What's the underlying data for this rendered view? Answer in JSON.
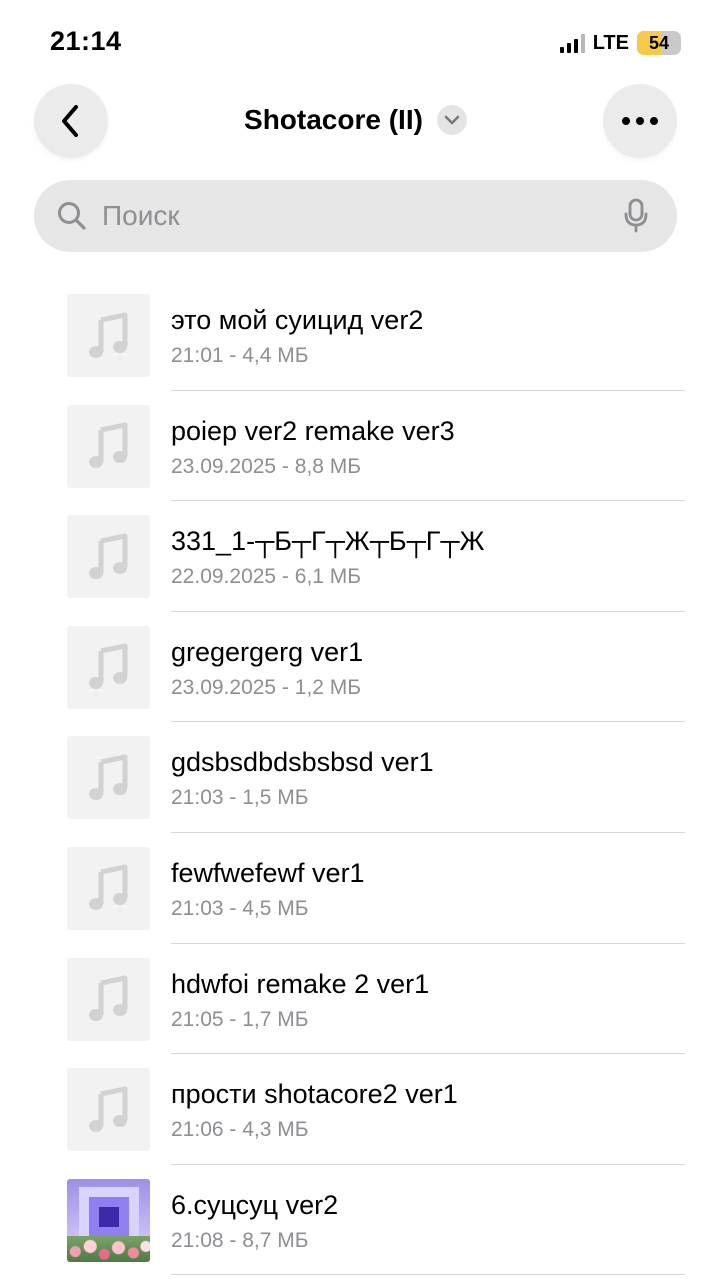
{
  "status_bar": {
    "time": "21:14",
    "network": "LTE",
    "battery": "54",
    "battery_level": 0.54,
    "battery_color": "#f7c948"
  },
  "header": {
    "back_icon": "chevron-left-icon",
    "title": "Shotacore (II)",
    "title_dropdown_icon": "chevron-down-icon",
    "more_icon": "ellipsis-icon"
  },
  "search": {
    "placeholder": "Поиск",
    "value": "",
    "icon": "search-icon",
    "mic_icon": "microphone-icon"
  },
  "files": [
    {
      "name": "это мой суицид ver2",
      "meta": "21:01 - 4,4 МБ",
      "thumb": "music-note-icon"
    },
    {
      "name": "poiep ver2 remake ver3",
      "meta": "23.09.2025 - 8,8 МБ",
      "thumb": "music-note-icon"
    },
    {
      "name": "331_1-┬Б┬Г┬Ж┬Б┬Г┬Ж",
      "meta": "22.09.2025 - 6,1 МБ",
      "thumb": "music-note-icon"
    },
    {
      "name": "gregergerg ver1",
      "meta": "23.09.2025 - 1,2 МБ",
      "thumb": "music-note-icon"
    },
    {
      "name": "gdsbsdbdsbsbsd ver1",
      "meta": "21:03 - 1,5 МБ",
      "thumb": "music-note-icon"
    },
    {
      "name": "fewfwefewf ver1",
      "meta": "21:03 - 4,5 МБ",
      "thumb": "music-note-icon"
    },
    {
      "name": "hdwfoi remake 2 ver1",
      "meta": "21:05 - 1,7 МБ",
      "thumb": "music-note-icon"
    },
    {
      "name": "прости shotacore2 ver1",
      "meta": "21:06 - 4,3 МБ",
      "thumb": "music-note-icon"
    },
    {
      "name": "6.суцсуц ver2",
      "meta": "21:08 - 8,7 МБ",
      "thumb": "album-art"
    }
  ]
}
